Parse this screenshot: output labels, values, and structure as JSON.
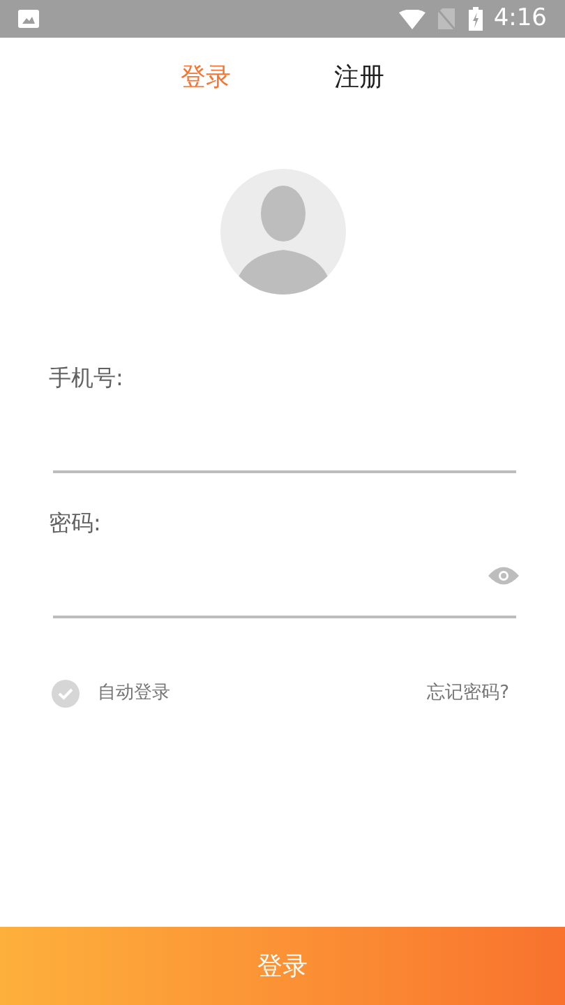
{
  "status_bar": {
    "time": "4:16"
  },
  "tabs": [
    {
      "label": "登录",
      "selected": true
    },
    {
      "label": "注册",
      "selected": false
    }
  ],
  "fields": [
    {
      "label": "手机号:",
      "kind": "phone"
    },
    {
      "label": "密码:",
      "kind": "password"
    }
  ],
  "auto_login": {
    "label": "自动登录",
    "checked": false
  },
  "forgot_link": "忘记密码?",
  "submit_button": "登录"
}
